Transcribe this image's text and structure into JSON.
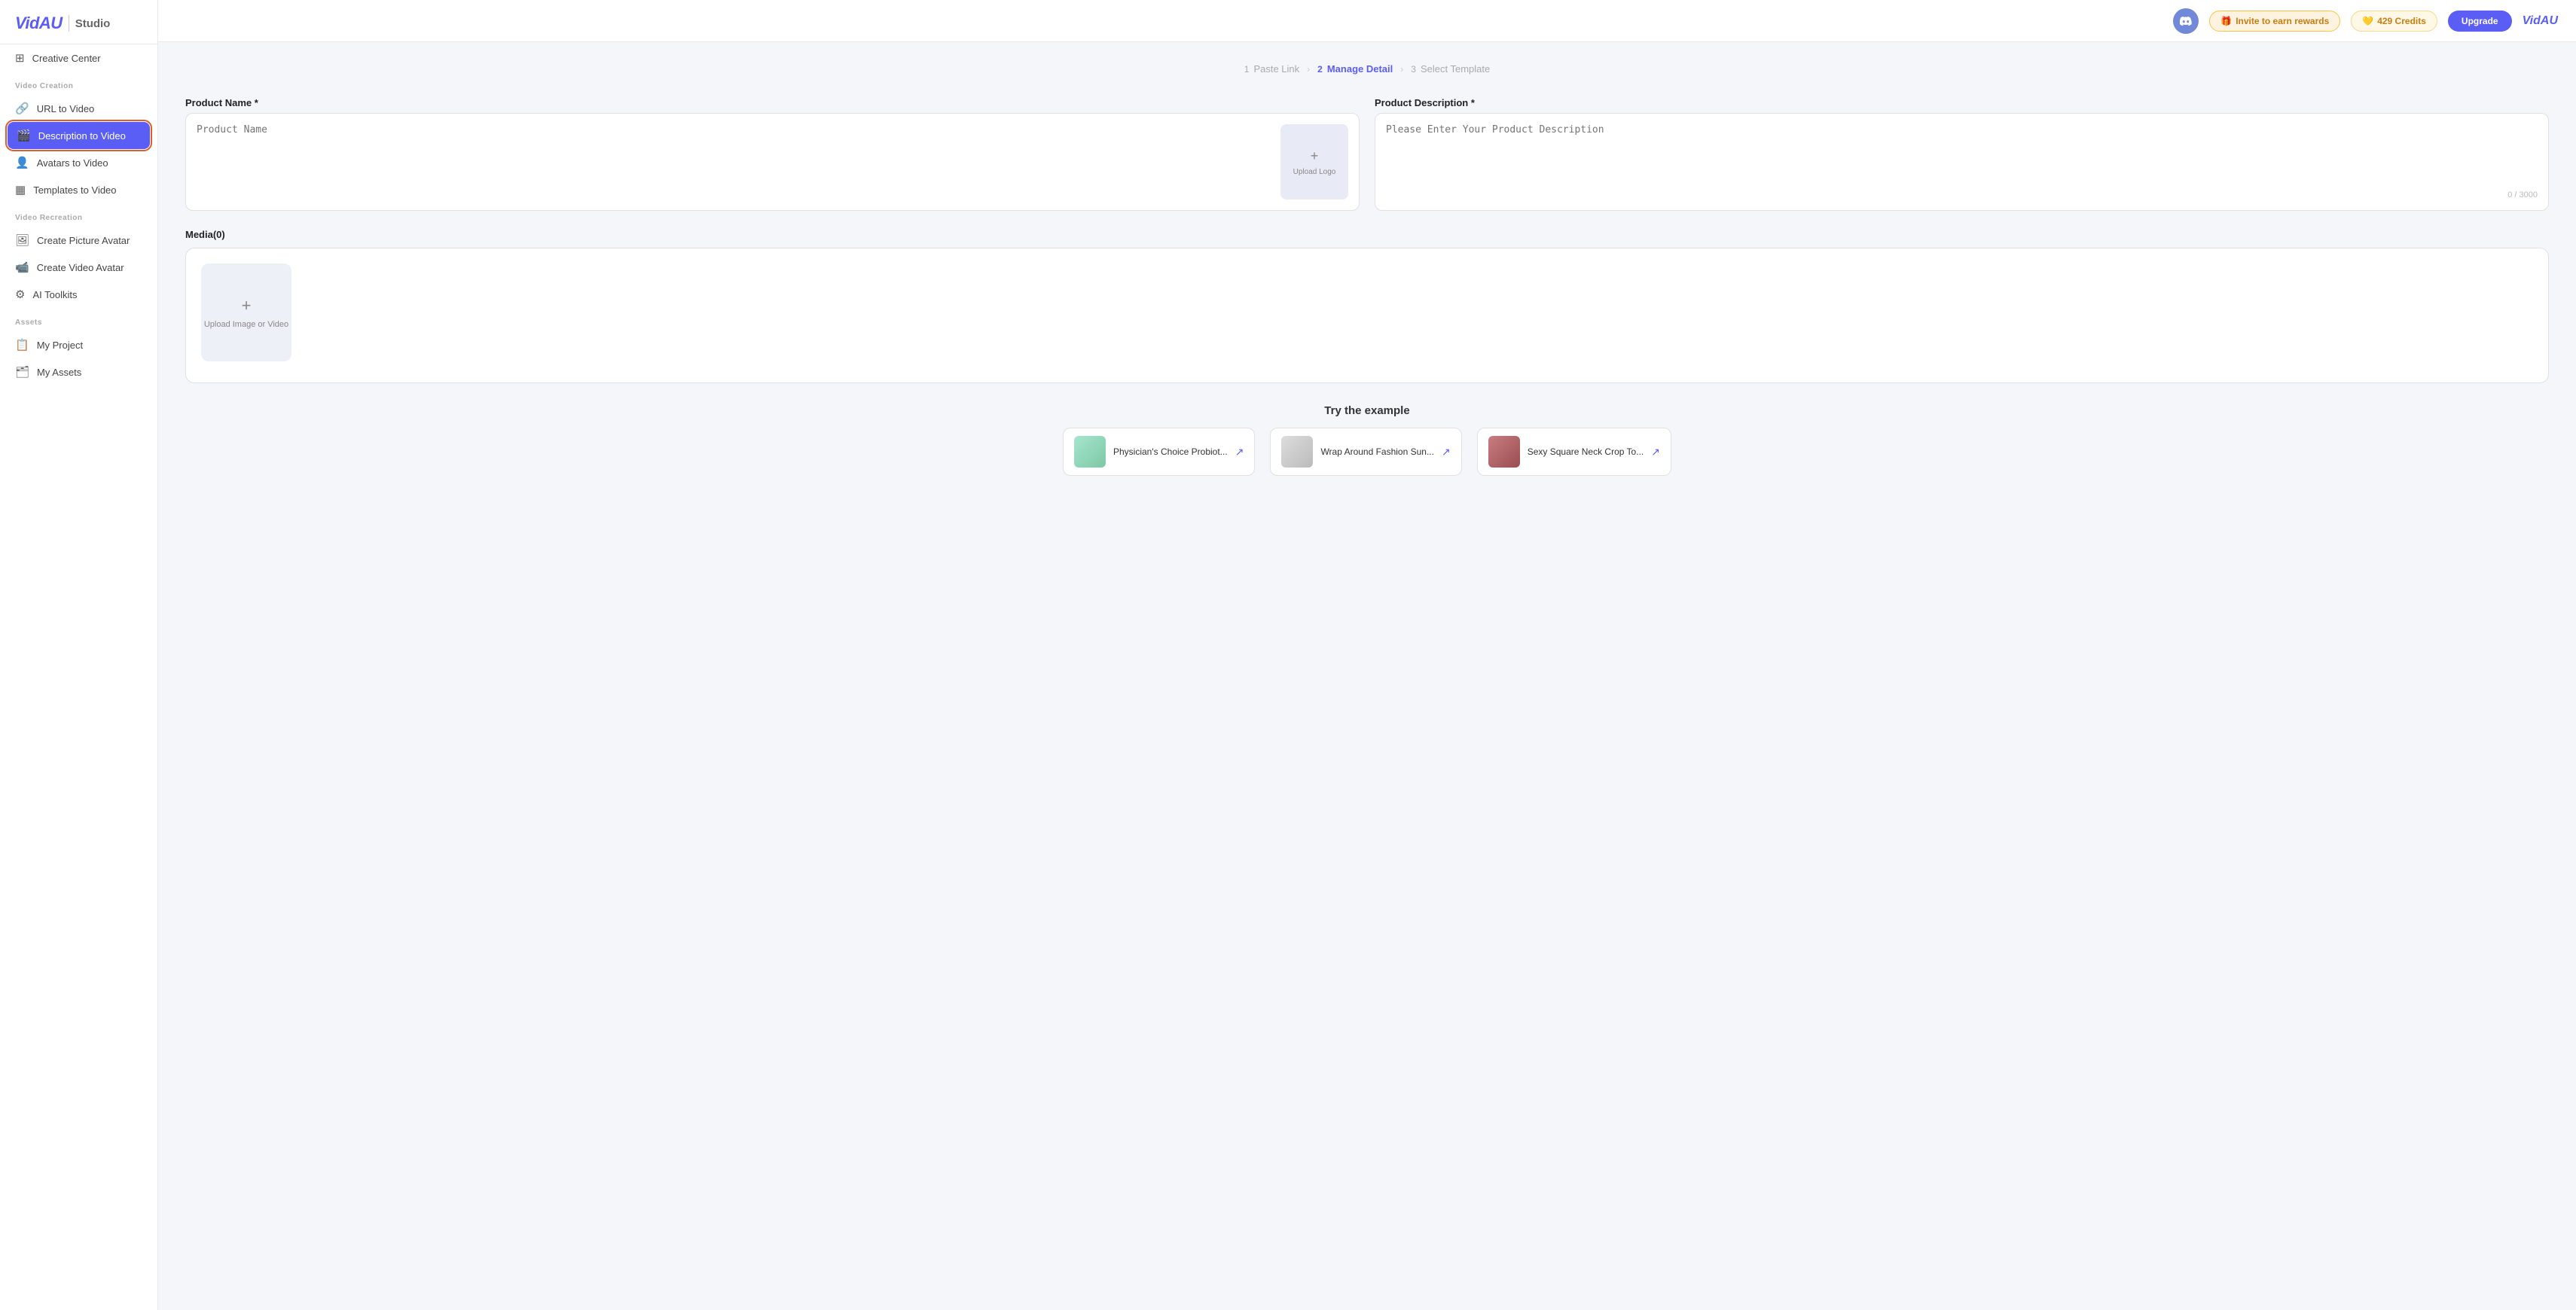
{
  "logo": {
    "brand": "VidAU",
    "separator": "|",
    "subtitle": "Studio"
  },
  "sidebar": {
    "sections": [
      {
        "label": "",
        "items": [
          {
            "id": "creative-center",
            "icon": "⊞",
            "label": "Creative Center",
            "active": false
          }
        ]
      },
      {
        "label": "Video Creation",
        "items": [
          {
            "id": "url-to-video",
            "icon": "🔗",
            "label": "URL to Video",
            "active": false
          },
          {
            "id": "description-to-video",
            "icon": "🎬",
            "label": "Description to Video",
            "active": true
          },
          {
            "id": "avatars-to-video",
            "icon": "👤",
            "label": "Avatars to Video",
            "active": false
          },
          {
            "id": "templates-to-video",
            "icon": "▦",
            "label": "Templates to Video",
            "active": false
          }
        ]
      },
      {
        "label": "Video Recreation",
        "items": [
          {
            "id": "create-picture-avatar",
            "icon": "🖼",
            "label": "Create Picture Avatar",
            "active": false
          },
          {
            "id": "create-video-avatar",
            "icon": "📹",
            "label": "Create Video Avatar",
            "active": false
          },
          {
            "id": "ai-toolkits",
            "icon": "⚙",
            "label": "AI Toolkits",
            "active": false
          }
        ]
      },
      {
        "label": "Assets",
        "items": [
          {
            "id": "my-project",
            "icon": "📋",
            "label": "My Project",
            "active": false
          },
          {
            "id": "my-assets",
            "icon": "🗂",
            "label": "My Assets",
            "active": false
          }
        ]
      }
    ]
  },
  "header": {
    "invite_label": "Invite to earn rewards",
    "credits_label": "429 Credits",
    "upgrade_label": "Upgrade",
    "brand_label": "VidAU"
  },
  "stepper": {
    "steps": [
      {
        "id": "paste-link",
        "num": "1",
        "label": "Paste Link",
        "active": false
      },
      {
        "id": "manage-detail",
        "num": "2",
        "label": "Manage Detail",
        "active": true
      },
      {
        "id": "select-template",
        "num": "3",
        "label": "Select Template",
        "active": false
      }
    ]
  },
  "form": {
    "product_name_label": "Product Name *",
    "product_name_placeholder": "Product Name",
    "upload_logo_label": "Upload Logo",
    "product_desc_label": "Product Description *",
    "product_desc_placeholder": "Please Enter Your Product Description",
    "char_count": "0 / 3000",
    "media_label": "Media(0)",
    "upload_media_label": "Upload Image or Video"
  },
  "try_example": {
    "title": "Try the example",
    "items": [
      {
        "id": "example-1",
        "thumb_class": "example-thumb-1",
        "label": "Physician's Choice Probiot..."
      },
      {
        "id": "example-2",
        "thumb_class": "example-thumb-2",
        "label": "Wrap Around Fashion Sun..."
      },
      {
        "id": "example-3",
        "thumb_class": "example-thumb-3",
        "label": "Sexy Square Neck Crop To..."
      }
    ]
  }
}
